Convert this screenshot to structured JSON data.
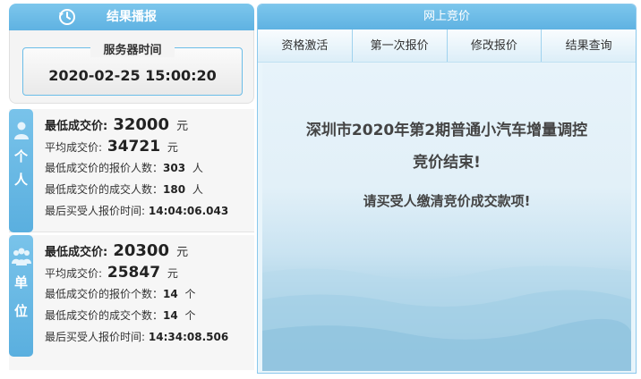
{
  "results": {
    "header": "结果播报",
    "server_time_label": "服务器时间",
    "server_time": "2020-02-25 15:00:20"
  },
  "person": {
    "tab_chars": [
      "个",
      "人"
    ],
    "lowest_label": "最低成交价:",
    "lowest_value": "32000",
    "avg_label": "平均成交价:",
    "avg_value": "34721",
    "currency": "元",
    "bidders_label": "最低成交价的报价人数：",
    "bidders_value": "303",
    "deals_label": "最低成交价的成交人数：",
    "deals_value": "180",
    "person_unit": "人",
    "last_time_label": "最后买受人报价时间:",
    "last_time_value": "14:04:06.043"
  },
  "unit": {
    "tab_chars": [
      "单",
      "位"
    ],
    "lowest_label": "最低成交价:",
    "lowest_value": "20300",
    "avg_label": "平均成交价:",
    "avg_value": "25847",
    "currency": "元",
    "bidders_label": "最低成交价的报价个数：",
    "bidders_value": "14",
    "deals_label": "最低成交价的成交个数：",
    "deals_value": "14",
    "count_unit": "个",
    "last_time_label": "最后买受人报价时间:",
    "last_time_value": "14:34:08.506"
  },
  "bidding": {
    "header": "网上竞价",
    "tabs": [
      {
        "label": "资格激活"
      },
      {
        "label": "第一次报价"
      },
      {
        "label": "修改报价"
      },
      {
        "label": "结果查询"
      }
    ],
    "message_line1": "深圳市2020年第2期普通小汽车增量调控",
    "message_line2": "竞价结束!",
    "message_line3": "请买受人缴清竞价成交款项!"
  },
  "colors": {
    "accent": "#5fb2e2",
    "panel_bg": "#f6f6f6"
  },
  "icons": {
    "results_header": "refresh-clock-icon",
    "person_tab": "person-icon",
    "unit_tab": "group-icon"
  }
}
